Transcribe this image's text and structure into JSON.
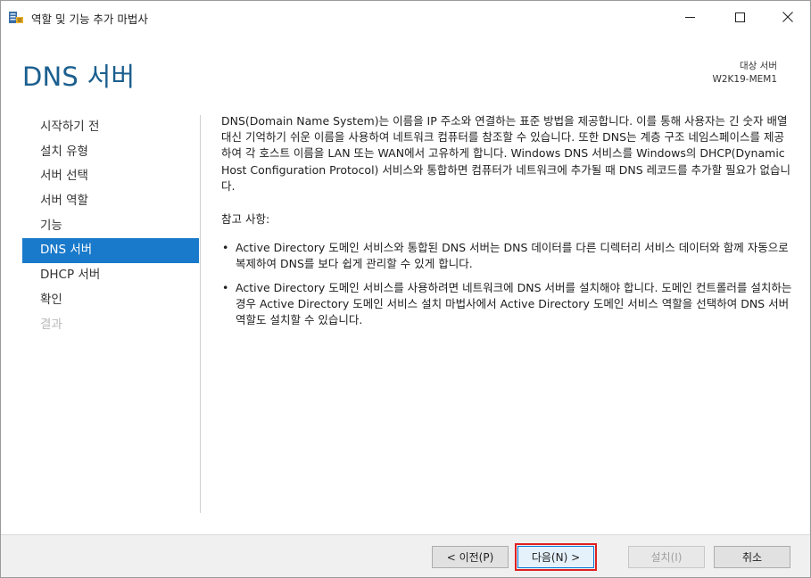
{
  "window": {
    "title": "역할 및 기능 추가 마법사",
    "icons": {
      "app": "server-manager-icon",
      "minimize": "minimize-icon",
      "maximize": "maximize-icon",
      "close": "close-icon"
    }
  },
  "header": {
    "page_title": "DNS 서버",
    "target_server_label": "대상 서버",
    "target_server_name": "W2K19-MEM1"
  },
  "nav": {
    "items": [
      {
        "label": "시작하기 전",
        "state": "normal"
      },
      {
        "label": "설치 유형",
        "state": "normal"
      },
      {
        "label": "서버 선택",
        "state": "normal"
      },
      {
        "label": "서버 역할",
        "state": "normal"
      },
      {
        "label": "기능",
        "state": "normal"
      },
      {
        "label": "DNS 서버",
        "state": "active"
      },
      {
        "label": "DHCP 서버",
        "state": "normal"
      },
      {
        "label": "확인",
        "state": "normal"
      },
      {
        "label": "결과",
        "state": "disabled"
      }
    ]
  },
  "content": {
    "intro": "DNS(Domain Name System)는 이름을 IP 주소와 연결하는 표준 방법을 제공합니다. 이를 통해 사용자는 긴 숫자 배열 대신 기억하기 쉬운 이름을 사용하여 네트워크 컴퓨터를 참조할 수 있습니다. 또한 DNS는 계층 구조 네임스페이스를 제공하여 각 호스트 이름을 LAN 또는 WAN에서 고유하게 합니다. Windows DNS 서비스를 Windows의 DHCP(Dynamic Host Configuration Protocol) 서비스와 통합하면 컴퓨터가 네트워크에 추가될 때 DNS 레코드를 추가할 필요가 없습니다.",
    "notes_heading": "참고 사항:",
    "notes": [
      "Active Directory 도메인 서비스와 통합된 DNS 서버는 DNS 데이터를 다른 디렉터리 서비스 데이터와 함께 자동으로 복제하여 DNS를 보다 쉽게 관리할 수 있게 합니다.",
      "Active Directory 도메인 서비스를 사용하려면 네트워크에 DNS 서버를 설치해야 합니다. 도메인 컨트롤러를 설치하는 경우 Active Directory 도메인 서비스 설치 마법사에서 Active Directory 도메인 서비스 역할을 선택하여 DNS 서버 역할도 설치할 수 있습니다."
    ]
  },
  "footer": {
    "prev_label": "< 이전(P)",
    "next_label": "다음(N) >",
    "install_label": "설치(I)",
    "cancel_label": "취소"
  },
  "colors": {
    "title_blue": "#1b5f8f",
    "nav_active_bg": "#1979ca",
    "highlight_red": "#e02020"
  }
}
